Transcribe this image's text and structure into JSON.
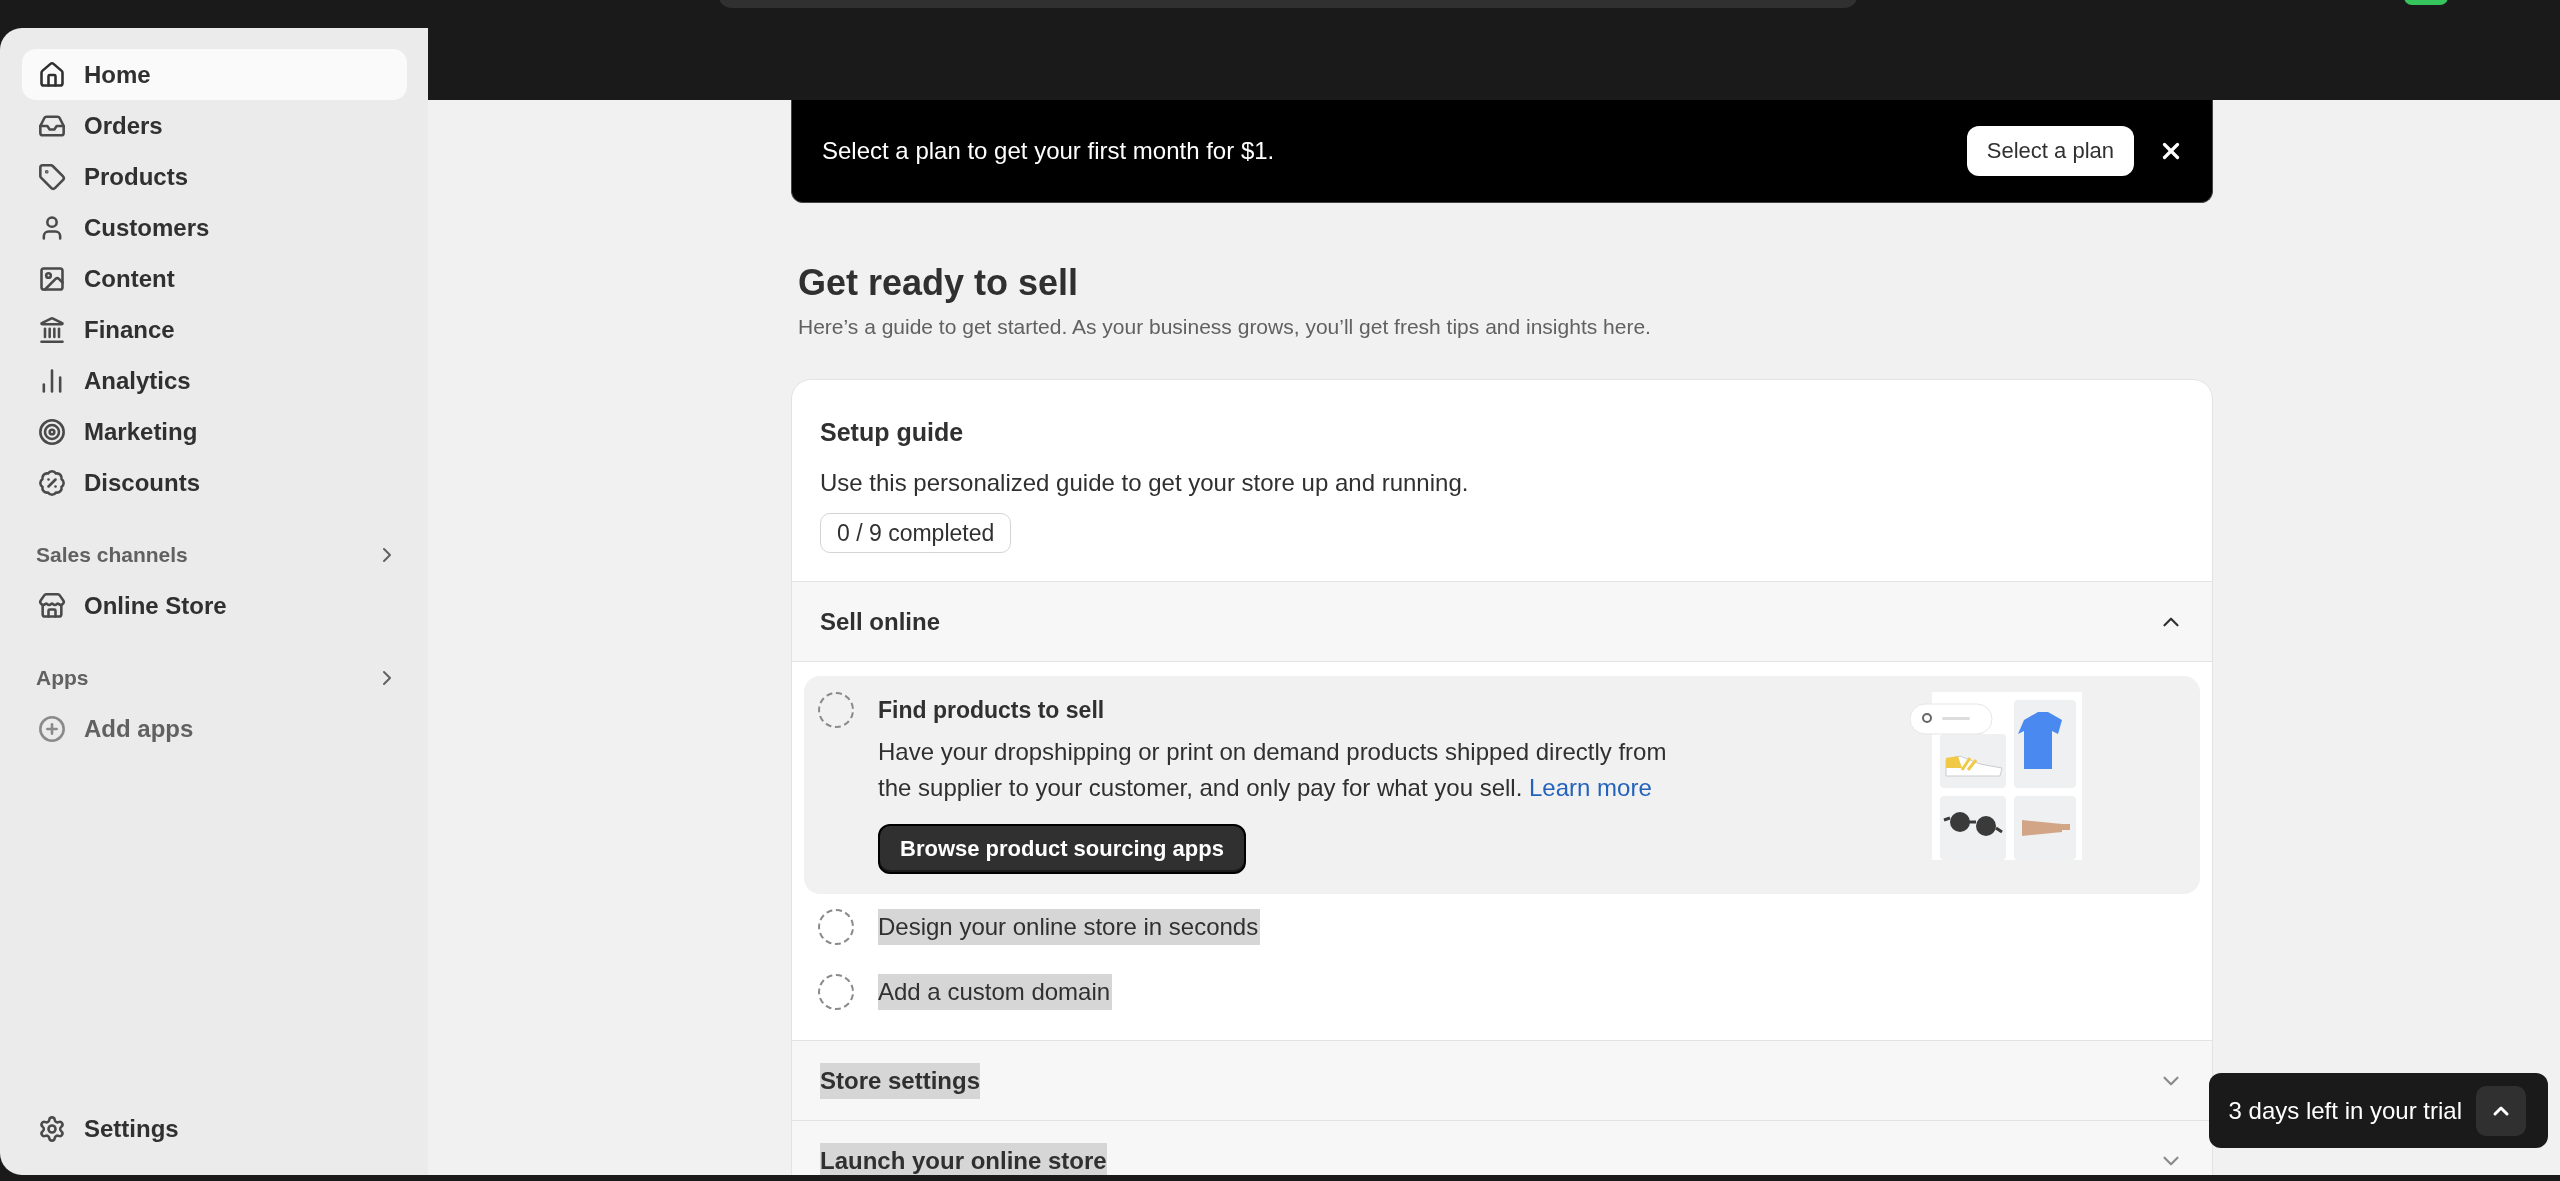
{
  "sidebar": {
    "nav": [
      {
        "label": "Home",
        "selected": true
      },
      {
        "label": "Orders",
        "selected": false
      },
      {
        "label": "Products",
        "selected": false
      },
      {
        "label": "Customers",
        "selected": false
      },
      {
        "label": "Content",
        "selected": false
      },
      {
        "label": "Finance",
        "selected": false
      },
      {
        "label": "Analytics",
        "selected": false
      },
      {
        "label": "Marketing",
        "selected": false
      },
      {
        "label": "Discounts",
        "selected": false
      }
    ],
    "sales_channels": {
      "title": "Sales channels",
      "expanded": false,
      "items": [
        {
          "label": "Online Store",
          "kind": "channel",
          "selected": false
        }
      ]
    },
    "apps": {
      "title": "Apps",
      "expanded": false,
      "items": [
        {
          "label": "Add apps",
          "kind": "add",
          "selected": false
        }
      ]
    },
    "settings": {
      "label": "Settings",
      "selected": false
    }
  },
  "banner": {
    "text": "Select a plan to get your first month for $1.",
    "button": "Select a plan"
  },
  "page": {
    "title": "Get ready to sell",
    "subtitle": "Here’s a guide to get started. As your business grows, you’ll get fresh tips and insights here."
  },
  "setup_guide": {
    "title": "Setup guide",
    "description": "Use this personalized guide to get your store up and running.",
    "progress": "0 / 9 completed",
    "sections": [
      {
        "title": "Sell online",
        "expanded": true,
        "highlighted": false,
        "tasks": [
          {
            "title": "Find products to sell",
            "completed": false,
            "expanded": true,
            "highlighted": false,
            "description": "Have your dropshipping or print on demand products shipped directly from the supplier to your customer, and only pay for what you sell.",
            "link": "Learn more",
            "button": "Browse product sourcing apps"
          },
          {
            "title": "Design your online store in seconds",
            "completed": false,
            "expanded": false,
            "highlighted": true
          },
          {
            "title": "Add a custom domain",
            "completed": false,
            "expanded": false,
            "highlighted": true
          }
        ]
      },
      {
        "title": "Store settings",
        "expanded": false,
        "highlighted": true
      },
      {
        "title": "Launch your online store",
        "expanded": false,
        "highlighted": true
      }
    ]
  },
  "trial_toast": {
    "text": "3 days left in your trial",
    "expanded": false
  }
}
